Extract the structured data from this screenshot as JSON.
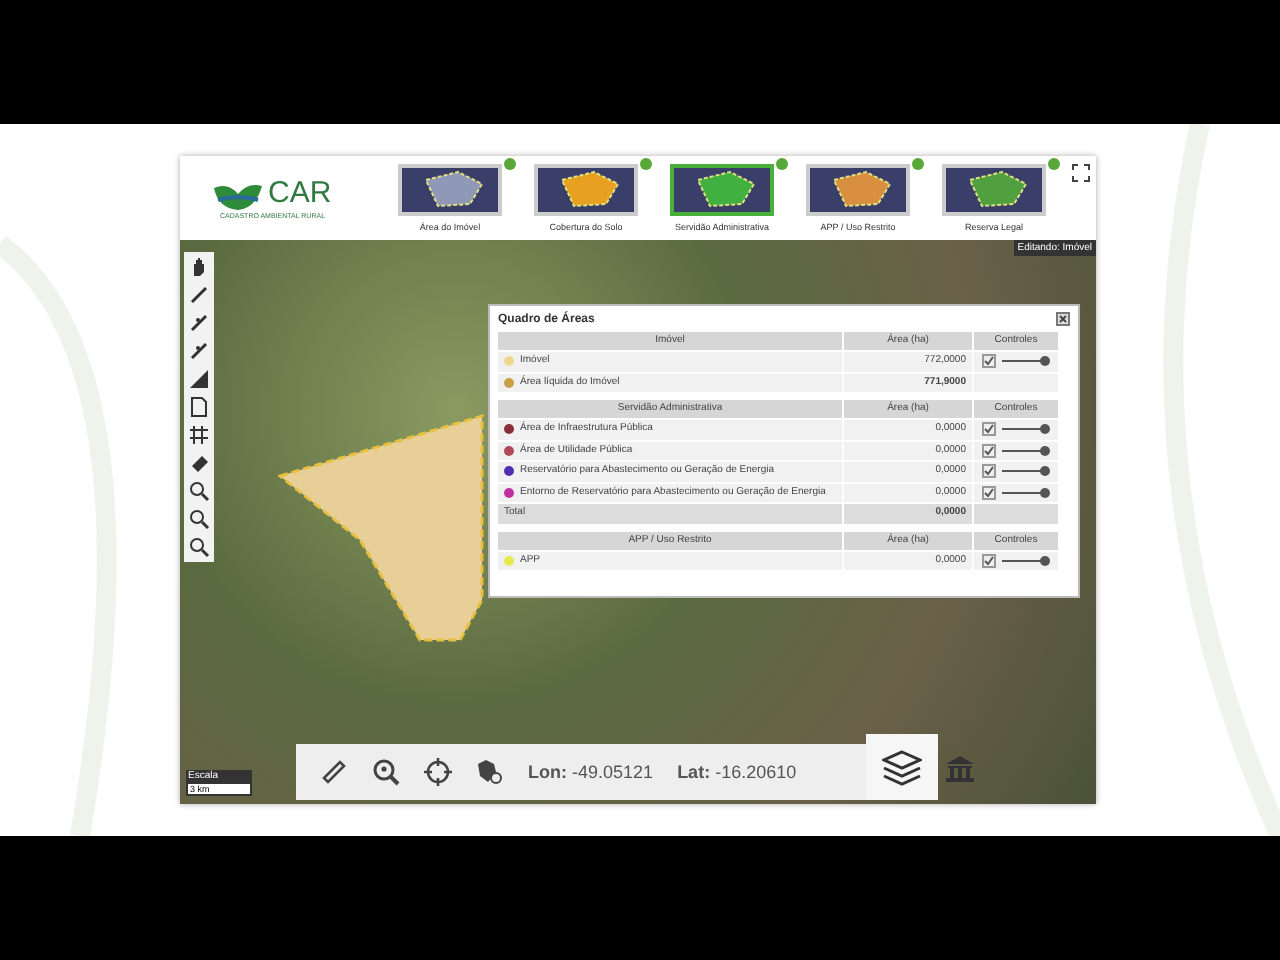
{
  "header": {
    "logo_title": "CAR",
    "logo_subtitle": "CADASTRO AMBIENTAL RURAL",
    "steps": [
      {
        "label": "Área do Imóvel",
        "selected": false
      },
      {
        "label": "Cobertura do Solo",
        "selected": false
      },
      {
        "label": "Servidão Administrativa",
        "selected": true
      },
      {
        "label": "APP / Uso Restrito",
        "selected": false
      },
      {
        "label": "Reserva Legal",
        "selected": false
      }
    ]
  },
  "map": {
    "mode_label": "Editando: Imóvel",
    "scale_label": "Escala",
    "scale_value": "3 km"
  },
  "panel": {
    "title": "Quadro de Áreas",
    "sections": [
      {
        "heading": "Imóvel",
        "area_heading": "Área (ha)",
        "controls_heading": "Controles",
        "rows": [
          {
            "kind": "layer",
            "name": "Imóvel",
            "color": "#eed890",
            "value": "772,0000",
            "checked": true,
            "level": 1
          },
          {
            "kind": "summary",
            "name": "Área líquida do Imóvel",
            "color": "#c8a048",
            "value": "771,9000"
          }
        ]
      },
      {
        "heading": "Servidão Administrativa",
        "area_heading": "Área (ha)",
        "controls_heading": "Controles",
        "rows": [
          {
            "kind": "layer",
            "name": "Área de Infraestrutura Pública",
            "color": "#8a3038",
            "value": "0,0000",
            "checked": true,
            "level": 1
          },
          {
            "kind": "layer",
            "name": "Área de Utilidade Pública",
            "color": "#b04858",
            "value": "0,0000",
            "checked": true,
            "level": 1
          },
          {
            "kind": "layer",
            "name": "Reservatório para Abastecimento ou Geração de Energia",
            "color": "#5030b0",
            "value": "0,0000",
            "checked": true,
            "level": 1
          },
          {
            "kind": "layer",
            "name": "Entorno de Reservatório para Abastecimento ou Geração de Energia",
            "color": "#c030a0",
            "value": "0,0000",
            "checked": true,
            "level": 1
          },
          {
            "kind": "total",
            "name": "Total",
            "value": "0,0000"
          }
        ]
      },
      {
        "heading": "APP / Uso Restrito",
        "area_heading": "Área (ha)",
        "controls_heading": "Controles",
        "rows": [
          {
            "kind": "layer",
            "name": "APP",
            "color": "#e8e850",
            "value": "0,0000",
            "checked": true,
            "level": 1
          }
        ]
      }
    ]
  },
  "bottom_bar": {
    "lon_label": "Lon:",
    "lon_value": "-49.05121",
    "lat_label": "Lat:",
    "lat_value": "-16.20610"
  }
}
